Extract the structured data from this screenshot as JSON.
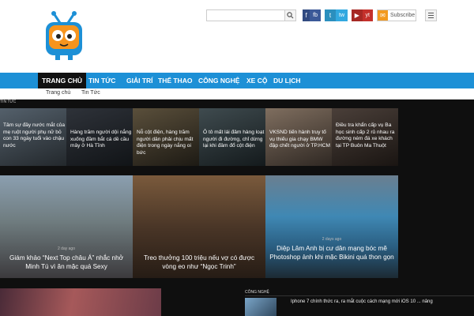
{
  "header": {
    "logo_alt": "TV mascot logo",
    "search_placeholder": "",
    "search_button_icon": "search-icon",
    "social": [
      {
        "icon": "facebook-icon",
        "glyph": "f",
        "label": "fb",
        "color": "#3b5998"
      },
      {
        "icon": "twitter-icon",
        "glyph": "t",
        "label": "tw",
        "color": "#33a9e0"
      },
      {
        "icon": "youtube-icon",
        "glyph": "▶",
        "label": "yt",
        "color": "#c4302b"
      }
    ],
    "subscribe": {
      "icon": "email-icon",
      "glyph": "✉",
      "label": "Subscribe"
    },
    "menu_icon": "hamburger-menu-icon"
  },
  "nav": {
    "items": [
      "TRANG CHỦ",
      "TIN TỨC",
      "GIẢI TRÍ",
      "THỂ THAO",
      "CÔNG NGHỆ",
      "XE CỘ",
      "DU LỊCH"
    ],
    "active_index": 0,
    "accent": "#1d90d6"
  },
  "subnav": {
    "items": [
      "Trang chủ",
      "Tin Tức"
    ]
  },
  "section_label": "TIN TỨC",
  "top_tiles": [
    {
      "title": "Tâm sự đầy nước mắt của mẹ ruột người phụ nữ bỏ con 33 ngày tuổi vào chậu nước"
    },
    {
      "title": "Hàng trăm người dội nắng xuống đầm bắt cá dề cầu mây ở Hà Tĩnh"
    },
    {
      "title": "Nỗ cột điện, hàng trăm người dân phải chịu mất điện trong ngày nắng oi bức"
    },
    {
      "title": "Ô tô mất lái đâm hàng loạt người đi đường, chỉ dừng lại khi đâm đổ cột điện"
    },
    {
      "title": "VKSND tiến hành truy tố vụ thiếu gia chạy BMW đập chết người ở TP.HCM"
    },
    {
      "title": "Điều tra khẩn cấp vụ Ba học sinh cấp 2 rủ nhau ra đường ném đá xe khách tại TP Buôn Ma Thuột"
    }
  ],
  "big_tiles": [
    {
      "title": "Giám khảo “Next Top châu Á” nhắc nhở Minh Tú vì ăn mặc quá Sexy",
      "meta": "2 day ago"
    },
    {
      "title": "Treo thưởng 100 triệu nếu vợ có được vòng eo như “Ngọc Trinh”",
      "meta": ""
    },
    {
      "title": "Diệp Lâm Anh bị cư dân mạng bóc mẽ Photoshop ảnh khi mặc Bikini quá thon gọn",
      "meta": "2 days ago"
    }
  ],
  "tech_section": {
    "label": "CÔNG NGHỆ",
    "first_title": "Iphone 7 chính thức ra, ra mắt cuộc cách mạng mới iOS 10 ... nâng"
  }
}
